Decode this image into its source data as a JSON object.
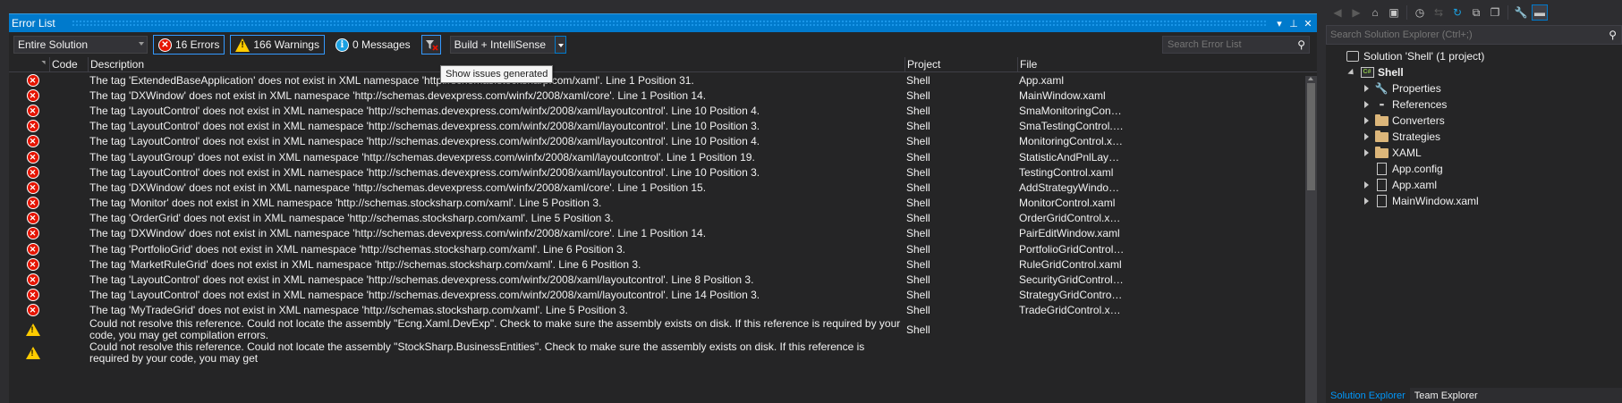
{
  "error_list": {
    "title": "Error List",
    "scope": "Entire Solution",
    "errors_label": "16 Errors",
    "warnings_label": "166 Warnings",
    "messages_label": "0 Messages",
    "build_filter": "Build + IntelliSense",
    "search_placeholder": "Search Error List",
    "tooltip": "Show issues generated",
    "columns": {
      "code": "Code",
      "description": "Description",
      "project": "Project",
      "file": "File"
    },
    "rows": [
      {
        "type": "error",
        "description": "The tag 'ExtendedBaseApplication' does not exist in XML namespace 'http://schemas.stocksharp.com/xaml'. Line 1 Position 31.",
        "project": "Shell",
        "file": "App.xaml"
      },
      {
        "type": "error",
        "description": "The tag 'DXWindow' does not exist in XML namespace 'http://schemas.devexpress.com/winfx/2008/xaml/core'. Line 1 Position 14.",
        "project": "Shell",
        "file": "MainWindow.xaml"
      },
      {
        "type": "error",
        "description": "The tag 'LayoutControl' does not exist in XML namespace 'http://schemas.devexpress.com/winfx/2008/xaml/layoutcontrol'. Line 10 Position 4.",
        "project": "Shell",
        "file": "SmaMonitoringControl.xa..."
      },
      {
        "type": "error",
        "description": "The tag 'LayoutControl' does not exist in XML namespace 'http://schemas.devexpress.com/winfx/2008/xaml/layoutcontrol'. Line 10 Position 3.",
        "project": "Shell",
        "file": "SmaTestingControl.xaml"
      },
      {
        "type": "error",
        "description": "The tag 'LayoutControl' does not exist in XML namespace 'http://schemas.devexpress.com/winfx/2008/xaml/layoutcontrol'. Line 10 Position 4.",
        "project": "Shell",
        "file": "MonitoringControl.xaml"
      },
      {
        "type": "error",
        "description": "The tag 'LayoutGroup' does not exist in XML namespace 'http://schemas.devexpress.com/winfx/2008/xaml/layoutcontrol'. Line 1 Position 19.",
        "project": "Shell",
        "file": "StatisticAndPnlLayoutGro..."
      },
      {
        "type": "error",
        "description": "The tag 'LayoutControl' does not exist in XML namespace 'http://schemas.devexpress.com/winfx/2008/xaml/layoutcontrol'. Line 10 Position 3.",
        "project": "Shell",
        "file": "TestingControl.xaml"
      },
      {
        "type": "error",
        "description": "The tag 'DXWindow' does not exist in XML namespace 'http://schemas.devexpress.com/winfx/2008/xaml/core'. Line 1 Position 15.",
        "project": "Shell",
        "file": "AddStrategyWindow.xaml"
      },
      {
        "type": "error",
        "description": "The tag 'Monitor' does not exist in XML namespace 'http://schemas.stocksharp.com/xaml'. Line 5 Position 3.",
        "project": "Shell",
        "file": "MonitorControl.xaml"
      },
      {
        "type": "error",
        "description": "The tag 'OrderGrid' does not exist in XML namespace 'http://schemas.stocksharp.com/xaml'. Line 5 Position 3.",
        "project": "Shell",
        "file": "OrderGridControl.xaml"
      },
      {
        "type": "error",
        "description": "The tag 'DXWindow' does not exist in XML namespace 'http://schemas.devexpress.com/winfx/2008/xaml/core'. Line 1 Position 14.",
        "project": "Shell",
        "file": "PairEditWindow.xaml"
      },
      {
        "type": "error",
        "description": "The tag 'PortfolioGrid' does not exist in XML namespace 'http://schemas.stocksharp.com/xaml'. Line 6 Position 3.",
        "project": "Shell",
        "file": "PortfolioGridControl.xaml"
      },
      {
        "type": "error",
        "description": "The tag 'MarketRuleGrid' does not exist in XML namespace 'http://schemas.stocksharp.com/xaml'. Line 6 Position 3.",
        "project": "Shell",
        "file": "RuleGridControl.xaml"
      },
      {
        "type": "error",
        "description": "The tag 'LayoutControl' does not exist in XML namespace 'http://schemas.devexpress.com/winfx/2008/xaml/layoutcontrol'. Line 8 Position 3.",
        "project": "Shell",
        "file": "SecurityGridControl.xaml"
      },
      {
        "type": "error",
        "description": "The tag 'LayoutControl' does not exist in XML namespace 'http://schemas.devexpress.com/winfx/2008/xaml/layoutcontrol'. Line 14 Position 3.",
        "project": "Shell",
        "file": "StrategyGridControl.xaml"
      },
      {
        "type": "error",
        "description": "The tag 'MyTradeGrid' does not exist in XML namespace 'http://schemas.stocksharp.com/xaml'. Line 5 Position 3.",
        "project": "Shell",
        "file": "TradeGridControl.xaml"
      },
      {
        "type": "warning",
        "description": "Could not resolve this reference. Could not locate the assembly \"Ecng.Xaml.DevExp\". Check to make sure the assembly exists on disk. If this reference is required by your code, you may get compilation errors.",
        "project": "Shell",
        "file": ""
      },
      {
        "type": "warning",
        "description": "Could not resolve this reference. Could not locate the assembly \"StockSharp.BusinessEntities\". Check to make sure the assembly exists on disk. If this reference is required by your code, you may get",
        "project": "",
        "file": ""
      }
    ]
  },
  "solution_explorer": {
    "search_placeholder": "Search Solution Explorer (Ctrl+;)",
    "tree": [
      {
        "label": "Solution 'Shell' (1 project)",
        "icon": "solution-icon",
        "level": 0,
        "expander": "none"
      },
      {
        "label": "Shell",
        "icon": "csharp-project-icon",
        "level": 1,
        "expander": "open",
        "bold": true
      },
      {
        "label": "Properties",
        "icon": "wrench-icon",
        "level": 2,
        "expander": "closed"
      },
      {
        "label": "References",
        "icon": "references-icon",
        "level": 2,
        "expander": "closed"
      },
      {
        "label": "Converters",
        "icon": "folder-icon",
        "level": 2,
        "expander": "closed"
      },
      {
        "label": "Strategies",
        "icon": "folder-icon",
        "level": 2,
        "expander": "closed"
      },
      {
        "label": "XAML",
        "icon": "folder-icon",
        "level": 2,
        "expander": "closed"
      },
      {
        "label": "App.config",
        "icon": "config-file-icon",
        "level": 2,
        "expander": "none"
      },
      {
        "label": "App.xaml",
        "icon": "xaml-file-icon",
        "level": 2,
        "expander": "closed"
      },
      {
        "label": "MainWindow.xaml",
        "icon": "xaml-file-icon",
        "level": 2,
        "expander": "closed"
      }
    ],
    "tabs": [
      "Solution Explorer",
      "Team Explorer"
    ]
  },
  "colors": {
    "accent": "#007acc",
    "error": "#e51400",
    "warning": "#ffcc00",
    "info": "#1ba1e2",
    "background": "#252526"
  }
}
